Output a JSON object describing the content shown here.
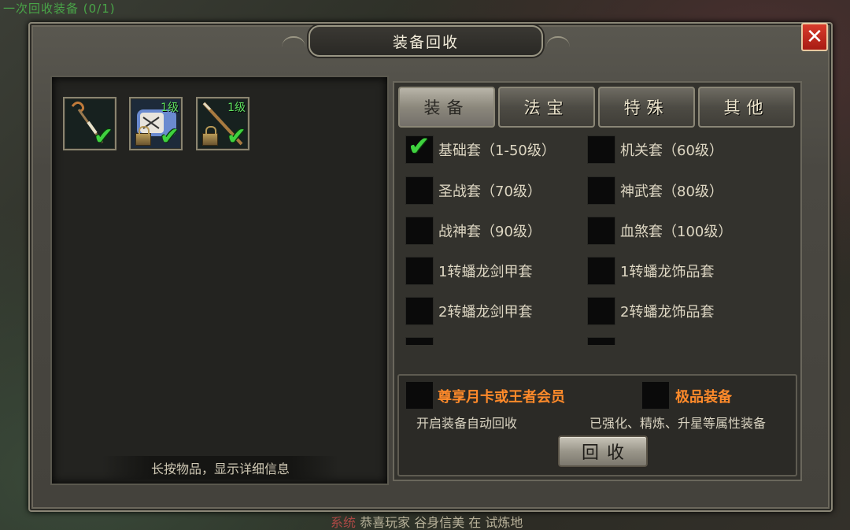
{
  "background": {
    "quest_text": "一次回收装备 (0/1)",
    "system_tag": "系统",
    "system_message": "恭喜玩家 谷身信美 在 试炼地"
  },
  "dialog": {
    "title": "装备回收",
    "close_label": "✕"
  },
  "inventory": {
    "items": [
      {
        "level": "",
        "checked": true,
        "locked": false,
        "icon": "staff-icon"
      },
      {
        "level": "1级",
        "checked": true,
        "locked": true,
        "icon": "scroll-icon"
      },
      {
        "level": "1级",
        "checked": true,
        "locked": true,
        "icon": "spear-icon"
      }
    ],
    "hint": "长按物品，显示详细信息"
  },
  "tabs": [
    {
      "label": "装备",
      "active": true
    },
    {
      "label": "法宝",
      "active": false
    },
    {
      "label": "特殊",
      "active": false
    },
    {
      "label": "其他",
      "active": false
    }
  ],
  "options": [
    {
      "label": "基础套（1-50级）",
      "checked": true
    },
    {
      "label": "机关套（60级）",
      "checked": false
    },
    {
      "label": "圣战套（70级）",
      "checked": false
    },
    {
      "label": "神武套（80级）",
      "checked": false
    },
    {
      "label": "战神套（90级）",
      "checked": false
    },
    {
      "label": "血煞套（100级）",
      "checked": false
    },
    {
      "label": "1转蟠龙剑甲套",
      "checked": false
    },
    {
      "label": "1转蟠龙饰品套",
      "checked": false
    },
    {
      "label": "2转蟠龙剑甲套",
      "checked": false
    },
    {
      "label": "2转蟠龙饰品套",
      "checked": false
    }
  ],
  "auto": {
    "vip_label": "尊享月卡或王者会员",
    "vip_desc": "开启装备自动回收",
    "premium_label": "极品装备",
    "premium_desc": "已强化、精炼、升星等属性装备",
    "vip_checked": false,
    "premium_checked": false
  },
  "recycle_button": "回收",
  "colors": {
    "accent_orange": "#ff8a2a",
    "check_green": "#3fd23f",
    "level_green": "#5ee05e",
    "close_red": "#c82a1c"
  }
}
